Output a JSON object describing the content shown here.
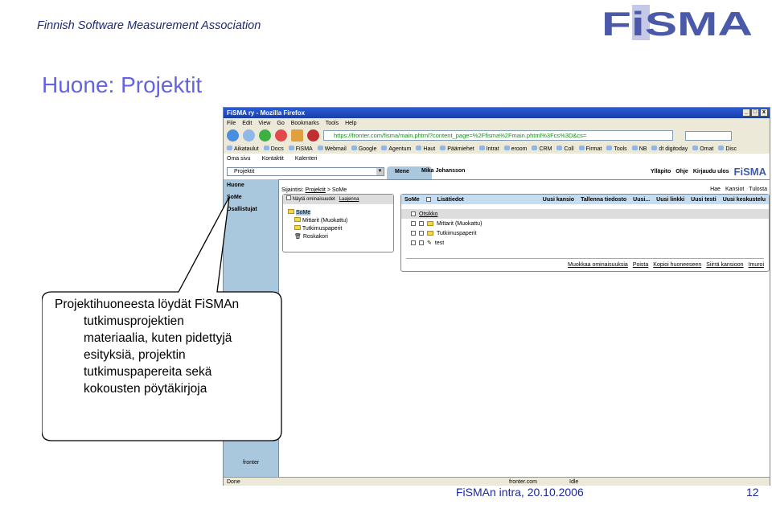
{
  "slide": {
    "association": "Finnish Software Measurement Association",
    "logo_text": "FiSMA",
    "title": "Huone: Projektit",
    "footer": "FiSMAn intra, 20.10.2006",
    "page_number": "12",
    "callout": [
      "Projektihuoneesta löydät FiSMAn",
      "tutkimusprojektien",
      "materiaalia, kuten pidettyjä",
      "esityksiä, projektin",
      "tutkimuspapereita sekä",
      "kokousten pöytäkirjoja"
    ]
  },
  "browser": {
    "title": "FiSMA ry - Mozilla Firefox",
    "menu": [
      "File",
      "Edit",
      "View",
      "Go",
      "Bookmarks",
      "Tools",
      "Help"
    ],
    "url": "https://fronter.com/fisma/main.phtml?content_page=%2Ffisma%2Fmain.phtml%3Fcs%3D&cs=",
    "bookmarks": [
      "Aikataulut",
      "Docs",
      "FiSMA",
      "Webmail",
      "Google",
      "Agentum",
      "Haut",
      "Päämiehet",
      "Intrat",
      "eroom",
      "CRM",
      "Coll",
      "Firmat",
      "Tools",
      "NB",
      "dt digitoday",
      "Omat",
      "Disc"
    ],
    "status": {
      "left": "Done",
      "host": "fronter.com",
      "state": "Idle"
    }
  },
  "fronter": {
    "top": [
      "Oma sivu",
      "Kontaktit",
      "Kalenteri"
    ],
    "room_select": "Projektit",
    "go": "Mene",
    "user": "Mika Johansson",
    "links": [
      "Ylläpito",
      "Ohje",
      "Kirjaudu ulos"
    ],
    "logo": "FiSMA",
    "sidebar": [
      "Huone",
      "SoMe",
      "Osallistujat"
    ],
    "sidebar_footer": "fronter",
    "breadcrumb_label": "Sijaintisi:",
    "breadcrumb_link": "Projektit",
    "breadcrumb_current": "> SoMe",
    "tools": [
      "Hae",
      "Kansiot",
      "Tulosta"
    ],
    "tree": {
      "show_props": "Näytä ominaisuudet",
      "expand": "Laajenna",
      "root": "SoMe",
      "items": [
        "Mittarit (Muokattu)",
        "Tutkimuspaperit",
        "Roskakori"
      ]
    },
    "list": {
      "folder": "SoMe",
      "more_info": "Lisätiedot",
      "buttons": [
        "Uusi kansio",
        "Tallenna tiedosto",
        "Uusi...",
        "Uusi linkki",
        "Uusi testi",
        "Uusi keskustelu"
      ],
      "header": "Otsikko",
      "rows": [
        "Mittarit (Muokattu)",
        "Tutkimuspaperit",
        "test"
      ],
      "actions": [
        "Muokkaa ominaisuuksia",
        "Poista",
        "Kopioi huoneeseen",
        "Siirrä kansioon",
        "Imuroi"
      ]
    }
  },
  "colors": {
    "title": "#6464e0",
    "footer": "#1b2a9e",
    "logo": "#4a5aa8",
    "sidebar": "#a9c7dd"
  }
}
